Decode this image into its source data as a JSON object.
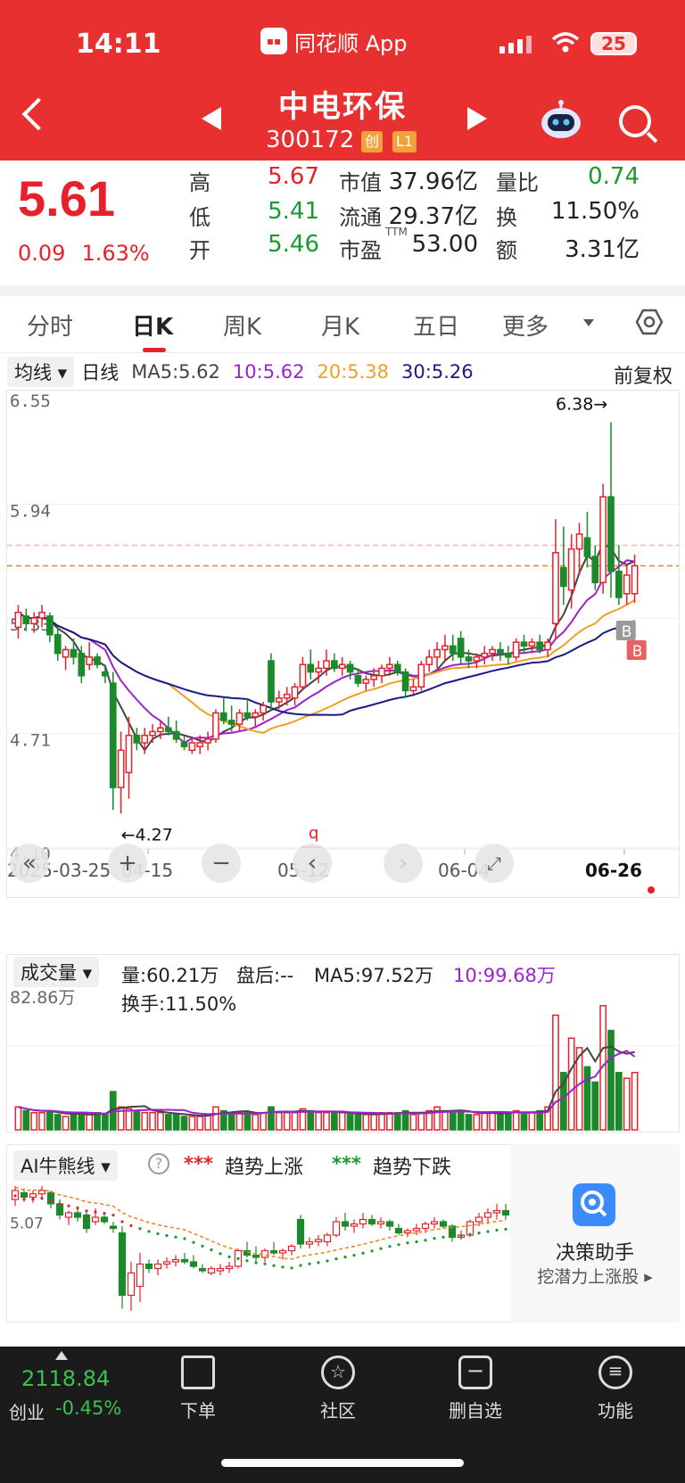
{
  "status": {
    "time": "14:11",
    "app": "同花顺 App",
    "battery": "25"
  },
  "header": {
    "name": "中电环保",
    "code": "300172",
    "tag1": "创",
    "tag2": "L1"
  },
  "quote": {
    "price": "5.61",
    "change": "0.09",
    "change_pct": "1.63%",
    "rows": [
      [
        {
          "l": "高",
          "v": "5.67",
          "c": "red"
        },
        {
          "l": "市值",
          "v": "37.96亿",
          "c": "dark"
        },
        {
          "l": "量比",
          "v": "0.74",
          "c": "green"
        }
      ],
      [
        {
          "l": "低",
          "v": "5.41",
          "c": "green"
        },
        {
          "l": "流通",
          "v": "29.37亿",
          "c": "dark"
        },
        {
          "l": "换",
          "v": "11.50%",
          "c": "dark"
        }
      ],
      [
        {
          "l": "开",
          "v": "5.46",
          "c": "green"
        },
        {
          "l": "市盈",
          "v": "53.00",
          "c": "dark",
          "sup": "TTM"
        },
        {
          "l": "额",
          "v": "3.31亿",
          "c": "dark"
        }
      ]
    ]
  },
  "tabs": [
    "分时",
    "日K",
    "周K",
    "月K",
    "五日",
    "更多"
  ],
  "ma": {
    "button": "均线",
    "period": "日线",
    "items": [
      {
        "t": "MA5:5.62",
        "c": "#444444"
      },
      {
        "t": "10:5.62",
        "c": "#a020d0"
      },
      {
        "t": "20:5.38",
        "c": "#f0a020"
      },
      {
        "t": "30:5.26",
        "c": "#1a1a8c"
      }
    ],
    "fuquan": "前复权"
  },
  "kline": {
    "y_labels": [
      "6.55",
      "5.94",
      "5.33",
      "4.71",
      "4.10"
    ],
    "high_label": "6.38→",
    "low_label": "←4.27",
    "dates": [
      "2025-03-25",
      "04-15",
      "05-12",
      "06-04",
      "06-26"
    ],
    "markers": {
      "b1": "B",
      "b2": "B",
      "q": "q"
    }
  },
  "chart_data": {
    "type": "candlestick",
    "ylim": [
      4.1,
      6.55
    ],
    "current_price": 5.61,
    "candles": [
      [
        5.28,
        5.4,
        5.22,
        5.36
      ],
      [
        5.34,
        5.38,
        5.26,
        5.3
      ],
      [
        5.3,
        5.36,
        5.25,
        5.33
      ],
      [
        5.33,
        5.4,
        5.28,
        5.36
      ],
      [
        5.34,
        5.36,
        5.2,
        5.24
      ],
      [
        5.24,
        5.28,
        5.1,
        5.14
      ],
      [
        5.12,
        5.18,
        5.05,
        5.16
      ],
      [
        5.16,
        5.22,
        5.08,
        5.12
      ],
      [
        5.14,
        5.18,
        4.98,
        5.02
      ],
      [
        5.08,
        5.2,
        5.05,
        5.12
      ],
      [
        5.12,
        5.14,
        5.06,
        5.08
      ],
      [
        5.04,
        5.08,
        4.98,
        5.02
      ],
      [
        4.98,
        5.04,
        4.3,
        4.42
      ],
      [
        4.42,
        4.72,
        4.28,
        4.62
      ],
      [
        4.5,
        4.8,
        4.36,
        4.7
      ],
      [
        4.7,
        4.74,
        4.62,
        4.66
      ],
      [
        4.66,
        4.74,
        4.6,
        4.7
      ],
      [
        4.7,
        4.76,
        4.66,
        4.72
      ],
      [
        4.72,
        4.78,
        4.68,
        4.74
      ],
      [
        4.74,
        4.8,
        4.7,
        4.72
      ],
      [
        4.72,
        4.78,
        4.66,
        4.68
      ],
      [
        4.66,
        4.7,
        4.62,
        4.64
      ],
      [
        4.62,
        4.68,
        4.6,
        4.66
      ],
      [
        4.64,
        4.7,
        4.6,
        4.66
      ],
      [
        4.66,
        4.72,
        4.62,
        4.68
      ],
      [
        4.68,
        4.84,
        4.66,
        4.82
      ],
      [
        4.82,
        4.9,
        4.76,
        4.78
      ],
      [
        4.78,
        4.86,
        4.72,
        4.76
      ],
      [
        4.76,
        4.84,
        4.72,
        4.82
      ],
      [
        4.82,
        4.9,
        4.78,
        4.8
      ],
      [
        4.8,
        4.84,
        4.74,
        4.82
      ],
      [
        4.82,
        4.88,
        4.78,
        4.86
      ],
      [
        5.1,
        5.14,
        4.84,
        4.88
      ],
      [
        4.88,
        4.94,
        4.84,
        4.9
      ],
      [
        4.9,
        4.96,
        4.86,
        4.92
      ],
      [
        4.9,
        4.98,
        4.86,
        4.96
      ],
      [
        4.96,
        5.12,
        4.94,
        5.08
      ],
      [
        5.08,
        5.16,
        5.0,
        5.04
      ],
      [
        5.04,
        5.1,
        4.98,
        5.06
      ],
      [
        5.06,
        5.16,
        5.02,
        5.1
      ],
      [
        5.1,
        5.14,
        5.04,
        5.06
      ],
      [
        5.06,
        5.12,
        5.02,
        5.08
      ],
      [
        5.08,
        5.1,
        5.0,
        5.04
      ],
      [
        5.02,
        5.06,
        4.96,
        4.98
      ],
      [
        4.98,
        5.02,
        4.94,
        5.0
      ],
      [
        5.0,
        5.06,
        4.96,
        5.02
      ],
      [
        5.02,
        5.08,
        4.98,
        5.06
      ],
      [
        5.06,
        5.12,
        5.02,
        5.08
      ],
      [
        5.08,
        5.1,
        5.02,
        5.04
      ],
      [
        5.04,
        5.06,
        4.9,
        4.94
      ],
      [
        4.94,
        5.0,
        4.92,
        4.96
      ],
      [
        4.96,
        5.1,
        4.94,
        5.08
      ],
      [
        5.08,
        5.16,
        5.04,
        5.12
      ],
      [
        5.12,
        5.2,
        5.06,
        5.16
      ],
      [
        5.16,
        5.24,
        5.1,
        5.18
      ],
      [
        5.18,
        5.24,
        5.1,
        5.14
      ],
      [
        5.22,
        5.26,
        5.08,
        5.12
      ],
      [
        5.12,
        5.16,
        5.06,
        5.1
      ],
      [
        5.1,
        5.14,
        5.06,
        5.12
      ],
      [
        5.12,
        5.18,
        5.08,
        5.14
      ],
      [
        5.14,
        5.18,
        5.1,
        5.16
      ],
      [
        5.16,
        5.2,
        5.1,
        5.14
      ],
      [
        5.14,
        5.18,
        5.08,
        5.12
      ],
      [
        5.12,
        5.22,
        5.1,
        5.2
      ],
      [
        5.2,
        5.24,
        5.14,
        5.18
      ],
      [
        5.18,
        5.22,
        5.14,
        5.2
      ],
      [
        5.2,
        5.24,
        5.14,
        5.16
      ],
      [
        5.16,
        5.22,
        5.12,
        5.2
      ],
      [
        5.3,
        5.86,
        5.22,
        5.68
      ],
      [
        5.6,
        5.82,
        5.4,
        5.5
      ],
      [
        5.48,
        5.78,
        5.38,
        5.7
      ],
      [
        5.7,
        5.84,
        5.56,
        5.78
      ],
      [
        5.76,
        5.9,
        5.6,
        5.66
      ],
      [
        5.66,
        5.72,
        5.48,
        5.52
      ],
      [
        5.52,
        6.05,
        5.46,
        5.98
      ],
      [
        5.98,
        6.38,
        5.44,
        5.58
      ],
      [
        5.58,
        5.72,
        5.4,
        5.44
      ],
      [
        5.46,
        5.62,
        5.4,
        5.56
      ],
      [
        5.46,
        5.67,
        5.41,
        5.61
      ]
    ],
    "volume": {
      "ylabel": "82.86万",
      "bars": [
        12,
        10,
        9,
        9,
        10,
        8,
        7,
        8,
        9,
        8,
        9,
        8,
        20,
        12,
        11,
        10,
        9,
        9,
        9,
        8,
        8,
        7,
        7,
        7,
        8,
        12,
        10,
        9,
        9,
        9,
        8,
        9,
        12,
        9,
        9,
        9,
        11,
        10,
        9,
        9,
        9,
        9,
        8,
        8,
        8,
        8,
        9,
        9,
        9,
        10,
        8,
        9,
        10,
        12,
        10,
        9,
        10,
        8,
        8,
        9,
        9,
        9,
        9,
        10,
        9,
        9,
        10,
        12,
        60,
        30,
        48,
        43,
        33,
        25,
        65,
        52,
        30,
        27,
        30
      ]
    }
  },
  "volume_panel": {
    "button": "成交量",
    "vol": "量:60.21万",
    "after": "盘后:--",
    "ma5": "MA5:97.52万",
    "ma10": "10:99.68万",
    "turnover": "换手:11.50%"
  },
  "ai_panel": {
    "button": "AI牛熊线",
    "help": "?",
    "up_stars": "***",
    "up": "趋势上涨",
    "down_stars": "***",
    "down": "趋势下跌",
    "ylabel": "5.07"
  },
  "helper": {
    "title": "决策助手",
    "sub": "挖潜力上涨股 ▸"
  },
  "bottom": {
    "index_value": "2118.84",
    "index_name": "创业",
    "index_change": "-0.45%",
    "items": [
      "下单",
      "社区",
      "删自选",
      "功能"
    ]
  }
}
